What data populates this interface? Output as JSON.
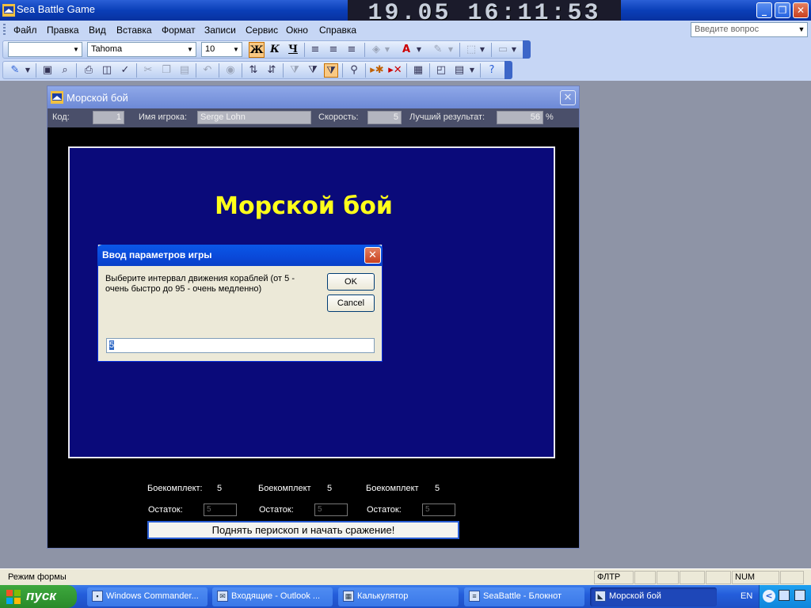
{
  "window": {
    "title": "Sea Battle Game",
    "clock": "19.05  16:11:53",
    "buttons": {
      "min": "_",
      "max": "❐",
      "close": "✕"
    }
  },
  "menu": {
    "items": [
      "Файл",
      "Правка",
      "Вид",
      "Вставка",
      "Формат",
      "Записи",
      "Сервис",
      "Окно",
      "Справка"
    ],
    "help_placeholder": "Введите вопрос"
  },
  "toolbar": {
    "object_combo": "",
    "font_name": "Tahoma",
    "font_size": "10",
    "bold": "Ж",
    "italic": "К",
    "underline": "Ч",
    "font_color_glyph": "A"
  },
  "form": {
    "title": "Морской бой",
    "close": "✕",
    "header": {
      "code_label": "Код:",
      "code_value": "1",
      "player_label": "Имя игрока:",
      "player_value": "Serge Lohn",
      "speed_label": "Скорость:",
      "speed_value": "5",
      "best_label": "Лучший результат:",
      "best_value": "56",
      "percent": "%"
    },
    "game_title": "Морской бой",
    "ammo": [
      {
        "label": "Боекомплект:",
        "value": "5"
      },
      {
        "label": "Боекомплект",
        "value": "5"
      },
      {
        "label": "Боекомплект",
        "value": "5"
      }
    ],
    "rest": [
      {
        "label": "Остаток:",
        "value": "5"
      },
      {
        "label": "Остаток:",
        "value": "5"
      },
      {
        "label": "Остаток:",
        "value": "5"
      }
    ],
    "start_button": "Поднять перископ и начать сражение!"
  },
  "dialog": {
    "title": "Ввод параметров игры",
    "close": "✕",
    "prompt": "Выберите интервал движения кораблей (от 5 - очень быстро до 95 - очень медленно)",
    "ok": "OK",
    "cancel": "Cancel",
    "input_value": "5"
  },
  "statusbar": {
    "text": "Режим формы",
    "filter": "ФЛТР",
    "num": "NUM"
  },
  "taskbar": {
    "start": "пуск",
    "tasks": [
      {
        "label": "Windows Commander...",
        "icon": "folder-icon"
      },
      {
        "label": "Входящие - Outlook ...",
        "icon": "outlook-icon"
      },
      {
        "label": "Калькулятор",
        "icon": "calculator-icon"
      },
      {
        "label": "SeaBattle - Блокнот",
        "icon": "notepad-icon"
      },
      {
        "label": "Морской бой",
        "icon": "access-form-icon"
      }
    ],
    "lang": "EN"
  }
}
